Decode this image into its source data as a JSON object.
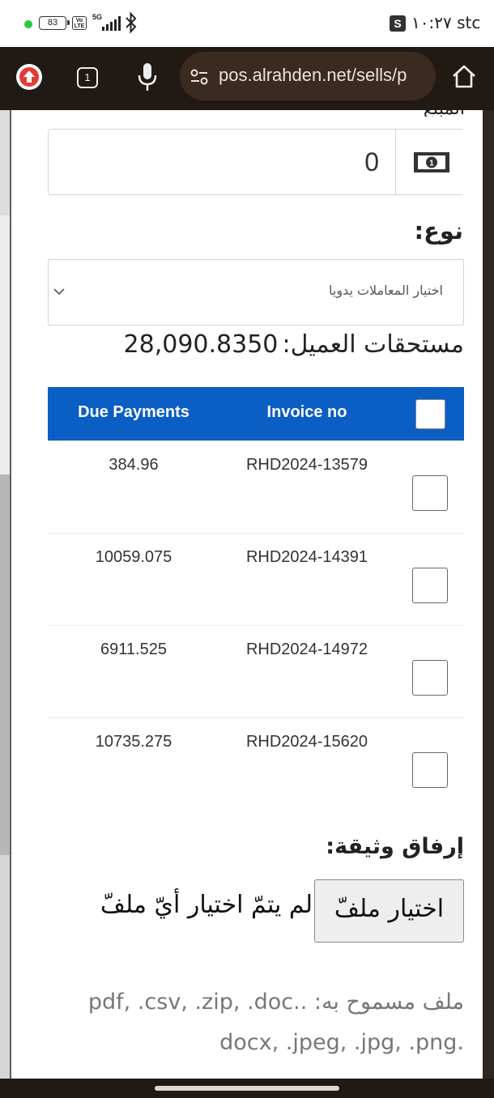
{
  "status_bar": {
    "battery": "83",
    "volte": "Vo LTE",
    "network": "5G",
    "sim_icon": "S",
    "time_carrier": "١٠:٢٧ stc"
  },
  "browser": {
    "tab_count": "1",
    "url": "pos.alrahden.net/sells/p"
  },
  "form": {
    "amount": {
      "label_cut": "المبلغ",
      "value": "0"
    },
    "type": {
      "label": "نوع:",
      "select_value": "اختيار المعاملات يدويا"
    },
    "dues": {
      "label": "مستحقات العميل:",
      "value": "28,090.8350"
    },
    "table": {
      "col_due": "Due Payments",
      "col_invoice": "Invoice no",
      "rows": [
        {
          "due": "384.96",
          "invoice": "RHD2024-13579"
        },
        {
          "due": "10059.075",
          "invoice": "RHD2024-14391"
        },
        {
          "due": "6911.525",
          "invoice": "RHD2024-14972"
        },
        {
          "due": "10735.275",
          "invoice": "RHD2024-15620"
        }
      ]
    },
    "attachment": {
      "label": "إرفاق وثيقة:",
      "button": "اختيار ملفّ",
      "status": "لم يتمّ اختيار أيّ ملفّ",
      "allowed_line1": "ملف مسموح به: ..pdf, .csv, .zip, .doc",
      "allowed_line2": ".docx, .jpeg, .jpg, .png"
    }
  },
  "colors": {
    "table_header": "#0b5ec4",
    "browser_bar": "#211a14",
    "url_pill": "#3a2a20",
    "update_badge": "#e53935"
  },
  "icons": [
    "bluetooth-icon",
    "update-icon",
    "tab-switcher-icon",
    "mic-icon",
    "site-settings-icon",
    "home-icon",
    "money-icon",
    "chevron-down-icon"
  ]
}
